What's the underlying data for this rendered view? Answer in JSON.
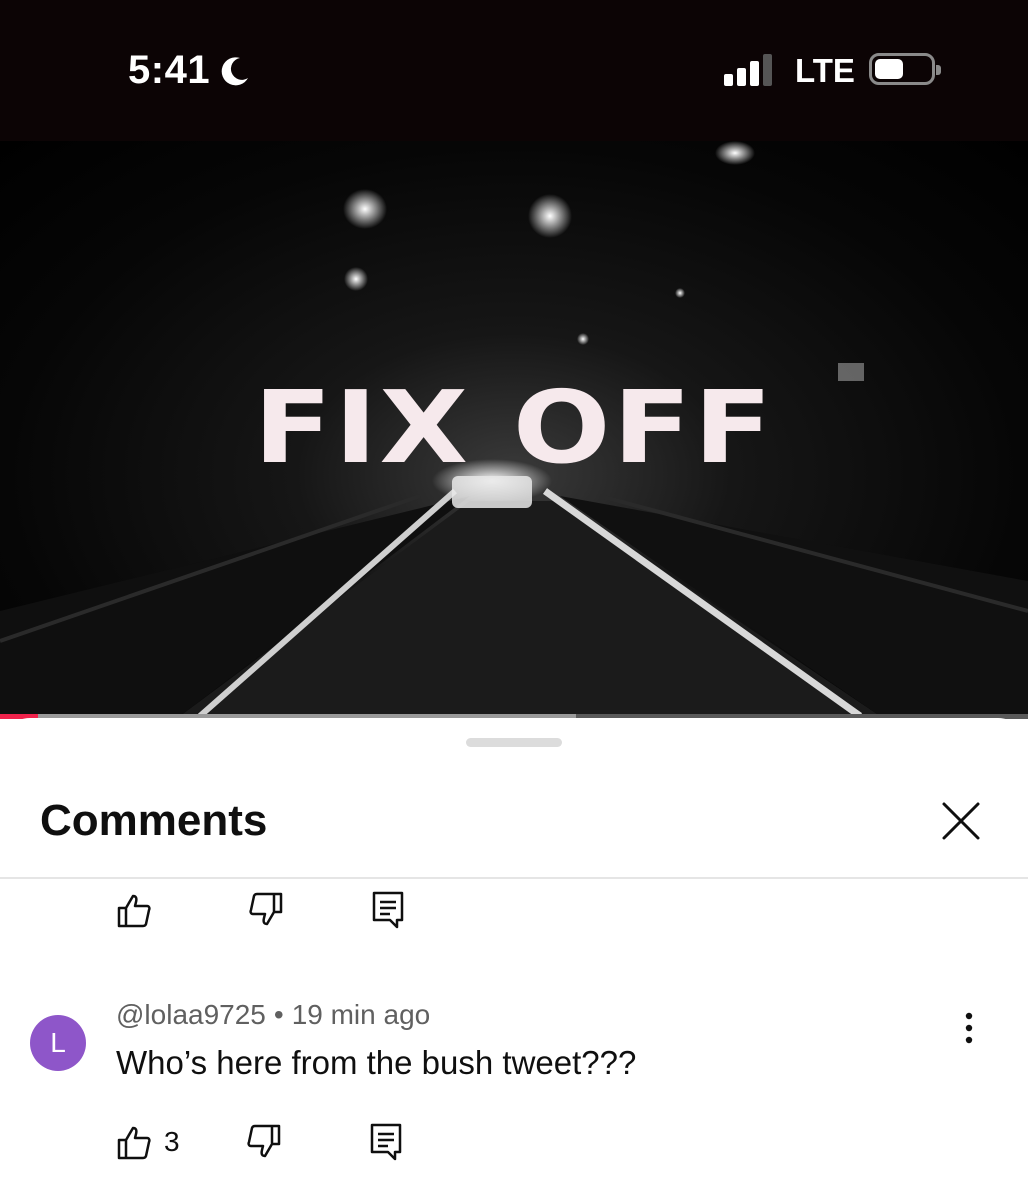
{
  "status": {
    "time": "5:41",
    "network": "LTE"
  },
  "video": {
    "title_overlay": "FIX OFF",
    "progress": 0.037,
    "buffered": 0.56
  },
  "comments": {
    "header": "Comments",
    "items": [
      {
        "id": "prev",
        "likes": ""
      },
      {
        "id": "lolaa",
        "avatar_letter": "L",
        "avatar_color": "#8e56c9",
        "author": "@lolaa9725",
        "time": "19 min ago",
        "text": "Who’s here from the bush tweet???",
        "likes": "3"
      }
    ]
  },
  "accent": "#f0224b"
}
